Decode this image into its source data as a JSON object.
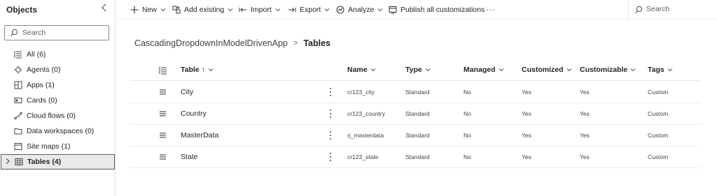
{
  "sidebar": {
    "title": "Objects",
    "search_placeholder": "Search",
    "items": [
      {
        "label": "All",
        "count": "(6)",
        "icon": "list-icon"
      },
      {
        "label": "Agents",
        "count": "(0)",
        "icon": "agent-icon"
      },
      {
        "label": "Apps",
        "count": "(1)",
        "icon": "apps-icon"
      },
      {
        "label": "Cards",
        "count": "(0)",
        "icon": "card-icon"
      },
      {
        "label": "Cloud flows",
        "count": "(0)",
        "icon": "flow-icon"
      },
      {
        "label": "Data workspaces",
        "count": "(0)",
        "icon": "folder-icon"
      },
      {
        "label": "Site maps",
        "count": "(1)",
        "icon": "sitemap-icon"
      },
      {
        "label": "Tables",
        "count": "(4)",
        "icon": "table-icon",
        "selected": true
      }
    ]
  },
  "commandbar": {
    "new": "New",
    "add_existing": "Add existing",
    "import": "Import",
    "export": "Export",
    "analyze": "Analyze",
    "publish": "Publish all customizations",
    "more": "···",
    "search_placeholder": "Search"
  },
  "breadcrumb": {
    "app": "CascadingDropdownInModelDrivenApp",
    "separator": ">",
    "current": "Tables"
  },
  "table": {
    "columns": {
      "table": "Table ↑",
      "name": "Name",
      "type": "Type",
      "managed": "Managed",
      "customized": "Customized",
      "customizable": "Customizable",
      "tags": "Tags"
    },
    "rows": [
      {
        "table": "City",
        "name": "cr123_city",
        "type": "Standard",
        "managed": "No",
        "customized": "Yes",
        "customizable": "Yes",
        "tags": "Custom"
      },
      {
        "table": "Country",
        "name": "cr123_country",
        "type": "Standard",
        "managed": "No",
        "customized": "Yes",
        "customizable": "Yes",
        "tags": "Custom"
      },
      {
        "table": "MasterData",
        "name": "rj_masterdata",
        "type": "Standard",
        "managed": "No",
        "customized": "Yes",
        "customizable": "Yes",
        "tags": "Custom"
      },
      {
        "table": "State",
        "name": "cr123_state",
        "type": "Standard",
        "managed": "No",
        "customized": "Yes",
        "customizable": "Yes",
        "tags": "Custom"
      }
    ]
  }
}
